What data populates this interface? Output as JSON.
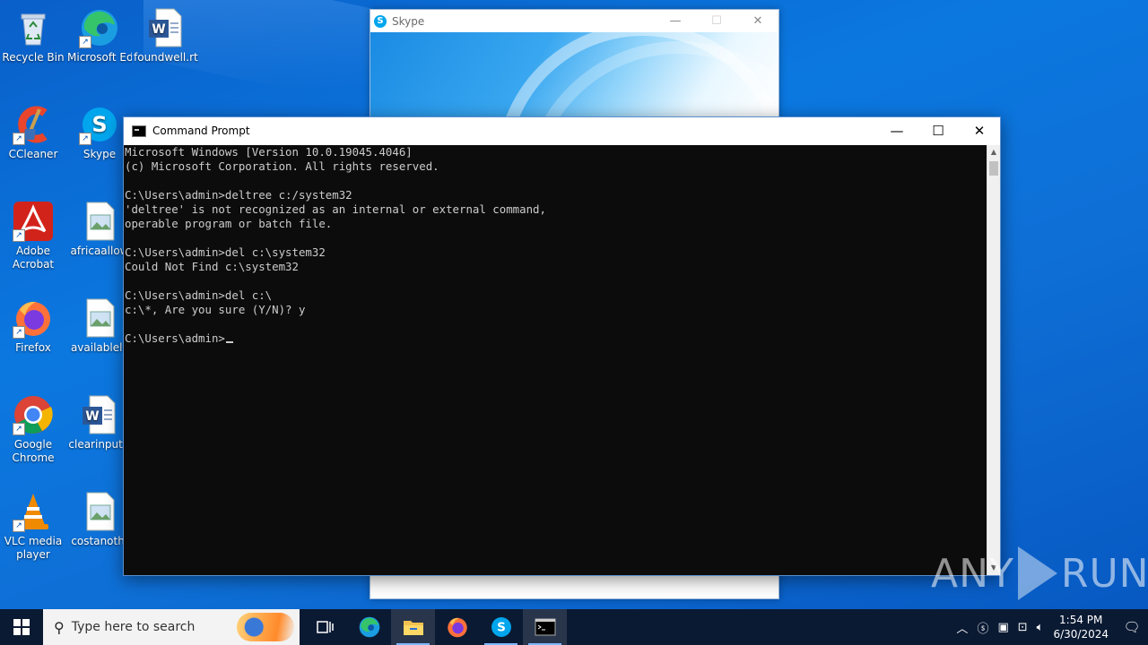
{
  "desktop": {
    "icons": [
      {
        "label": "Recycle Bin",
        "icon": "recycle-bin-icon"
      },
      {
        "label": "Microsoft Edge",
        "icon": "edge-icon"
      },
      {
        "label": "foundwell.rtf",
        "icon": "word-document-icon"
      },
      {
        "label": "CCleaner",
        "icon": "ccleaner-icon"
      },
      {
        "label": "Skype",
        "icon": "skype-icon"
      },
      {
        "label": "Adobe Acrobat",
        "icon": "acrobat-icon"
      },
      {
        "label": "africaallow",
        "icon": "image-file-icon"
      },
      {
        "label": "Firefox",
        "icon": "firefox-icon"
      },
      {
        "label": "availablelc",
        "icon": "image-file-icon"
      },
      {
        "label": "Google Chrome",
        "icon": "chrome-icon"
      },
      {
        "label": "clearinput.r",
        "icon": "word-document-icon"
      },
      {
        "label": "VLC media player",
        "icon": "vlc-icon"
      },
      {
        "label": "costanoth.",
        "icon": "image-file-icon"
      }
    ]
  },
  "skype_window": {
    "title": "Skype",
    "controls": {
      "minimize": "—",
      "maximize": "☐",
      "close": "✕"
    }
  },
  "cmd_window": {
    "title": "Command Prompt",
    "controls": {
      "minimize": "—",
      "maximize": "☐",
      "close": "✕"
    },
    "lines": [
      "Microsoft Windows [Version 10.0.19045.4046]",
      "(c) Microsoft Corporation. All rights reserved.",
      "",
      "C:\\Users\\admin>deltree c:/system32",
      "'deltree' is not recognized as an internal or external command,",
      "operable program or batch file.",
      "",
      "C:\\Users\\admin>del c:\\system32",
      "Could Not Find c:\\system32",
      "",
      "C:\\Users\\admin>del c:\\",
      "c:\\*, Are you sure (Y/N)? y",
      "",
      "C:\\Users\\admin>"
    ]
  },
  "watermark": {
    "left": "ANY",
    "right": "RUN"
  },
  "taskbar": {
    "search_placeholder": "Type here to search",
    "apps": [
      {
        "name": "task-view",
        "icon": "task-view-icon"
      },
      {
        "name": "edge",
        "icon": "edge-icon"
      },
      {
        "name": "file-explorer",
        "icon": "folder-icon"
      },
      {
        "name": "firefox",
        "icon": "firefox-icon"
      },
      {
        "name": "skype",
        "icon": "skype-icon"
      },
      {
        "name": "command-prompt",
        "icon": "cmd-icon"
      }
    ],
    "clock": {
      "time": "1:54 PM",
      "date": "6/30/2024"
    }
  },
  "colors": {
    "desktop": "#0b78e0",
    "console_bg": "#0c0c0c",
    "console_fg": "#cccccc",
    "taskbar": "#0b1a33"
  }
}
